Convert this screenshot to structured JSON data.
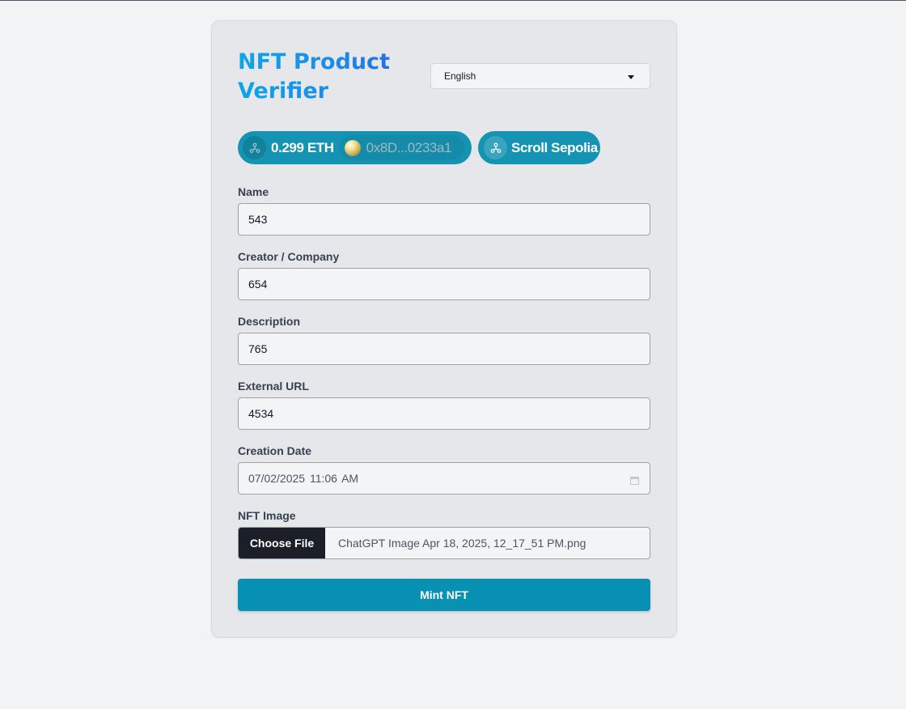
{
  "header": {
    "title_line1": "NFT Product",
    "title_line2": "Verifier",
    "language": "English"
  },
  "wallet": {
    "balance": "0.299 ETH",
    "address": "0x8D...0233a1",
    "network": "Scroll Sepolia"
  },
  "form": {
    "name_label": "Name",
    "name_value": "543",
    "creator_label": "Creator / Company",
    "creator_value": "654",
    "description_label": "Description",
    "description_value": "765",
    "url_label": "External URL",
    "url_value": "4534",
    "date_label": "Creation Date",
    "date_value": "07/02/2025  11:06  AM",
    "image_label": "NFT Image",
    "choose_file_label": "Choose File",
    "file_name": "ChatGPT Image Apr 18, 2025, 12_17_51 PM.png",
    "submit_label": "Mint NFT"
  },
  "colors": {
    "accent": "#0891b2",
    "title_gradient_start": "#0ea5e9",
    "title_gradient_end": "#2563eb",
    "wallet_pill": "#1593b2"
  },
  "icons": {
    "network": "network-nodes-icon",
    "avatar": "wallet-avatar-icon",
    "language_caret": "caret-down-icon",
    "calendar": "calendar-icon"
  }
}
